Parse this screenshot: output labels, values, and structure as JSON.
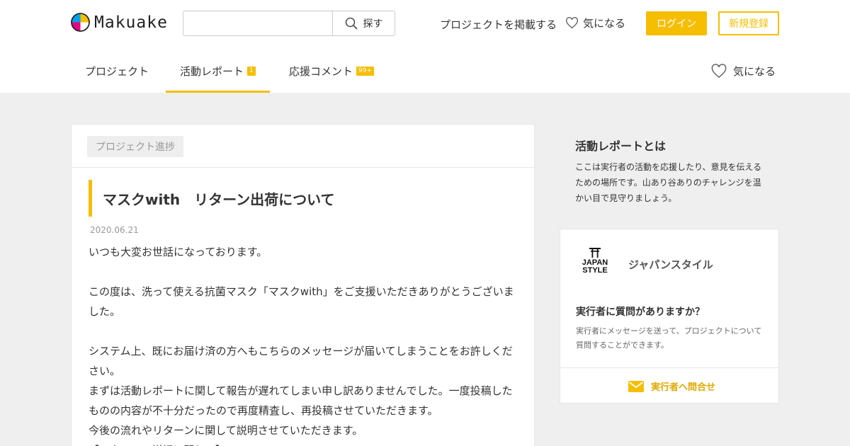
{
  "header": {
    "brand": "Makuake",
    "search": {
      "value": "",
      "button_label": "探す"
    },
    "post_project_link": "プロジェクトを掲載する",
    "favorite_label": "気になる",
    "login_label": "ログイン",
    "signup_label": "新規登録"
  },
  "tabs": [
    {
      "label": "プロジェクト",
      "badge": ""
    },
    {
      "label": "活動レポート",
      "badge": "1",
      "active": true
    },
    {
      "label": "応援コメント",
      "badge": "99+"
    }
  ],
  "tab_favorite_label": "気になる",
  "report": {
    "category": "プロジェクト進捗",
    "title": "マスクwith　リターン出荷について",
    "date": "2020.06.21",
    "paragraphs": [
      "いつも大変お世話になっております。",
      "",
      "この度は、洗って使える抗菌マスク「マスクwith」をご支援いただきありがとうございました。",
      "",
      "システム上、既にお届け済の方へもこちらのメッセージが届いてしまうことをお許しください。",
      "まずは活動レポートに関して報告が遅れてしまい申し訳ありませんでした。一度投稿したものの内容が不十分だったので再度精査し、再投稿させていただきます。",
      "今後の流れやリターンに関して説明させていただきます。",
      "【リターンの詳細に関して】"
    ]
  },
  "sidebar": {
    "about_title": "活動レポートとは",
    "about_text": "ここは実行者の活動を応援したり、意見を伝えるための場所です。山あり谷ありのチャレンジを温かい目で見守りましょう。",
    "owner": {
      "logo_text": [
        "JAPAN",
        "STYLE"
      ],
      "name": "ジャパンスタイル",
      "question_title": "実行者に質問がありますか？",
      "question_text": "実行者にメッセージを送って、プロジェクトについて質問することができます。",
      "contact_label": "実行者へ問合せ"
    }
  },
  "colors": {
    "accent": "#f5be00",
    "background": "#efefef",
    "contact_text": "#e0a800"
  }
}
